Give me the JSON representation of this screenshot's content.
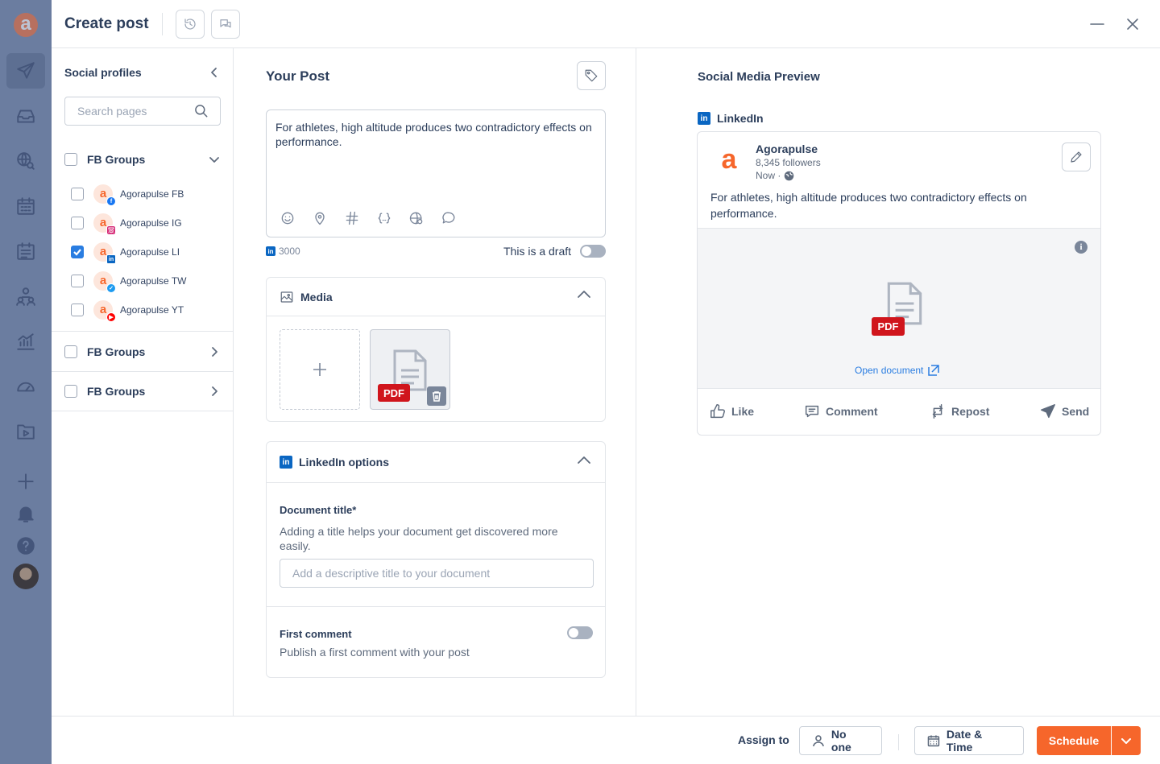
{
  "window": {
    "title": "Create post"
  },
  "brand": {
    "logo_letter": "a",
    "accent": "#f6662b"
  },
  "sidebar": {
    "title": "Social profiles",
    "search_placeholder": "Search pages",
    "groups": [
      {
        "label": "FB Groups",
        "expanded": true,
        "checked": false
      },
      {
        "label": "FB Groups",
        "expanded": false,
        "checked": false
      },
      {
        "label": "FB Groups",
        "expanded": false,
        "checked": false
      }
    ],
    "profiles": [
      {
        "label": "Agorapulse FB",
        "network": "facebook",
        "checked": false
      },
      {
        "label": "Agorapulse IG",
        "network": "instagram",
        "checked": false
      },
      {
        "label": "Agorapulse LI",
        "network": "linkedin",
        "checked": true
      },
      {
        "label": "Agorapulse TW",
        "network": "twitter",
        "checked": false
      },
      {
        "label": "Agorapulse YT",
        "network": "youtube",
        "checked": false
      }
    ]
  },
  "post": {
    "title": "Your Post",
    "text": "For athletes, high altitude produces two contradictory effects on performance.",
    "char_count": "3000",
    "draft_label": "This is a draft",
    "draft_on": false
  },
  "media": {
    "title": "Media",
    "attachment_badge": "PDF"
  },
  "linkedin_options": {
    "title": "LinkedIn options",
    "doc_title_label": "Document title*",
    "doc_title_help": "Adding a title helps your document get discovered more easily.",
    "doc_title_placeholder": "Add a descriptive title to your document",
    "first_comment_label": "First comment",
    "first_comment_help": "Publish a first comment with your post",
    "first_comment_on": false
  },
  "preview": {
    "title": "Social Media Preview",
    "network_label": "LinkedIn",
    "page_name": "Agorapulse",
    "followers": "8,345 followers",
    "time": "Now ·",
    "text": "For athletes, high altitude produces two contradictory effects on performance.",
    "badge": "PDF",
    "open_document": "Open document",
    "actions": {
      "like": "Like",
      "comment": "Comment",
      "repost": "Repost",
      "send": "Send"
    }
  },
  "footer": {
    "assign_label": "Assign to",
    "assignee": "No one",
    "date_time": "Date & Time",
    "schedule": "Schedule"
  }
}
